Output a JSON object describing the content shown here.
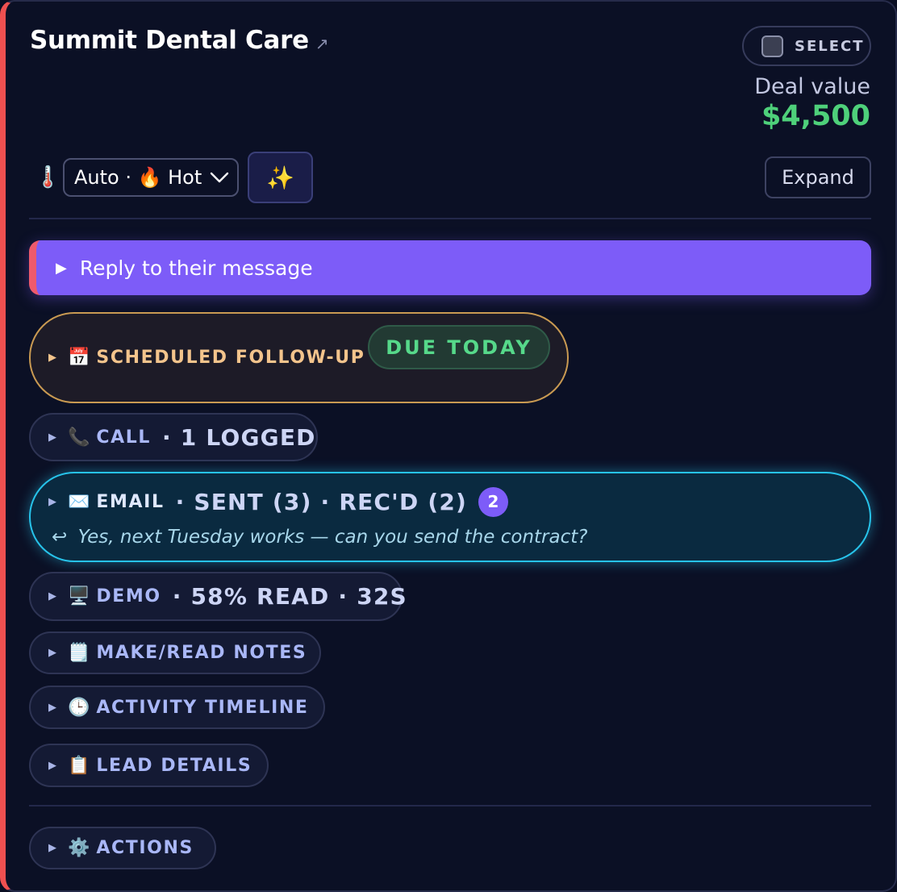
{
  "header": {
    "title": "Summit Dental Care",
    "select_label": "SELECT",
    "deal_label": "Deal value",
    "deal_value": "$4,500"
  },
  "controls": {
    "temperature_value": "Auto · 🔥 Hot",
    "expand_label": "Expand"
  },
  "reply_bar": {
    "label": "Reply to their message"
  },
  "sections": {
    "followup": {
      "label": "SCHEDULED FOLLOW-UP",
      "badge": "DUE TODAY"
    },
    "call": {
      "label": "CALL",
      "meta": "· 1 LOGGED"
    },
    "email": {
      "label": "EMAIL",
      "meta": "· SENT (3) · REC'D (2)",
      "count": "2",
      "preview": "Yes, next Tuesday works — can you send the contract?"
    },
    "demo": {
      "label": "DEMO",
      "meta": "· 58% READ · 32S"
    },
    "notes": {
      "label": "MAKE/READ NOTES"
    },
    "timeline": {
      "label": "ACTIVITY TIMELINE"
    },
    "lead_details": {
      "label": "LEAD DETAILS"
    },
    "actions": {
      "label": "ACTIONS"
    }
  },
  "icons": {
    "external": "↗",
    "thermometer": "🌡️",
    "chevron": "chevron-down",
    "sparkle": "✨",
    "triangle": "▶",
    "calendar": "📅",
    "phone": "📞",
    "envelope": "✉️",
    "monitor": "🖥️",
    "notepad": "🗒️",
    "clock": "🕒",
    "clipboard": "📋",
    "gear": "⚙️",
    "reply": "↩"
  },
  "colors": {
    "accent_purple": "#7d5cf8",
    "deal_green": "#4ed07a",
    "email_cyan": "#27c3ea",
    "followup_gold": "#c99a52",
    "left_border_red": "#ef5050"
  }
}
